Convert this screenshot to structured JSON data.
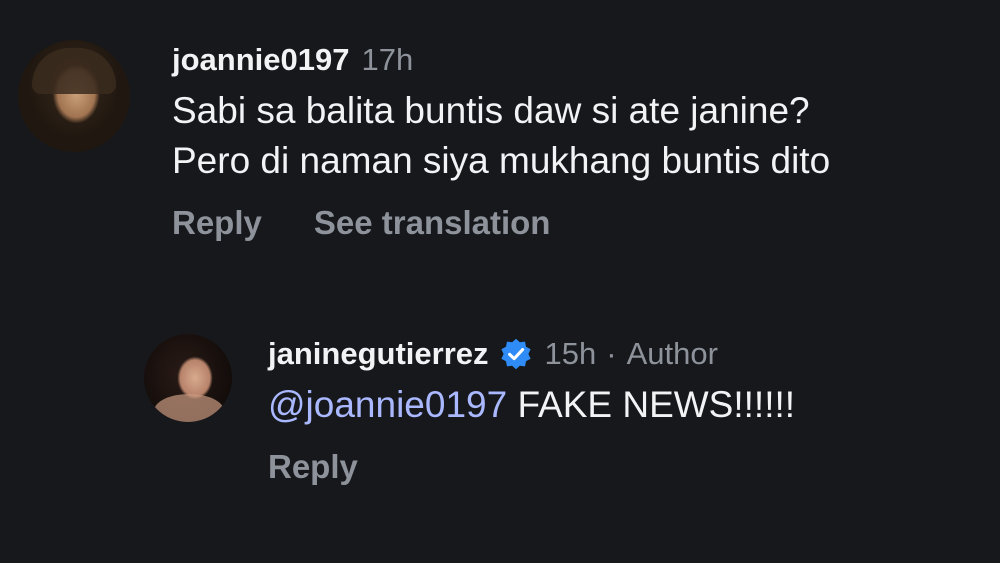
{
  "comments": [
    {
      "username": "joannie0197",
      "time": "17h",
      "lines": [
        "Sabi sa balita buntis daw si ate janine?",
        "Pero di naman siya mukhang buntis dito"
      ],
      "actions": {
        "reply": "Reply",
        "translate": "See translation"
      }
    },
    {
      "username": "janinegutierrez",
      "verified_icon": "verified-badge-icon",
      "time": "15h",
      "separator": "·",
      "author_label": "Author",
      "mention": "@joannie0197",
      "text": "FAKE NEWS!!!!!!",
      "actions": {
        "reply": "Reply"
      }
    }
  ],
  "colors": {
    "background": "#16181c",
    "primary_text": "#f2f3f5",
    "secondary_text": "#8e939b",
    "mention": "#aab9ff",
    "verified": "#2f8bf5"
  }
}
